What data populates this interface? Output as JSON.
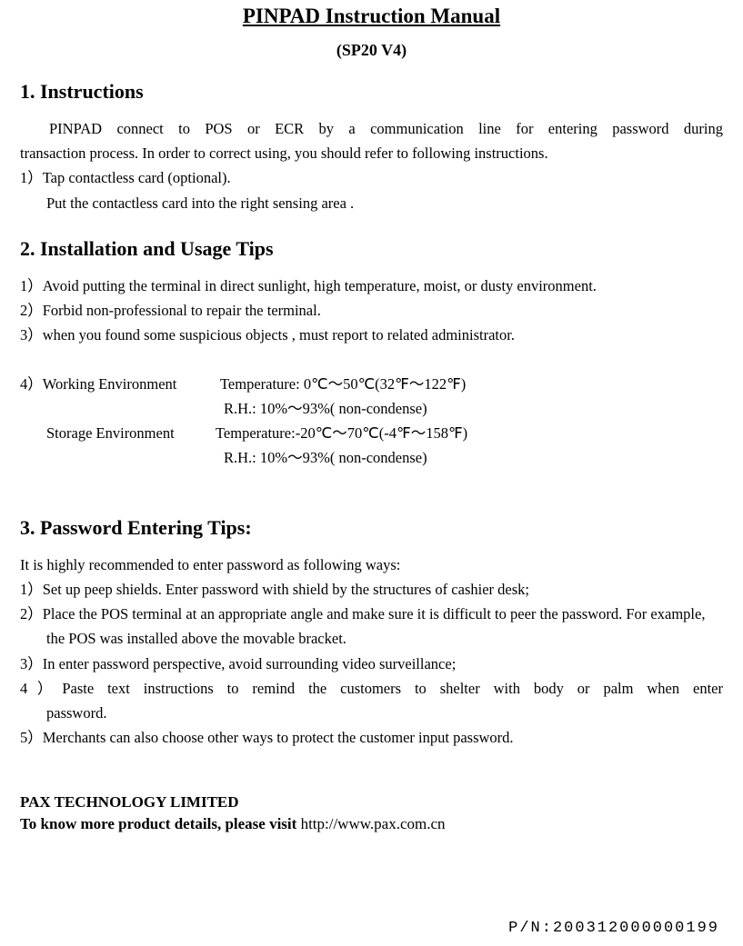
{
  "title": "PINPAD Instruction Manual",
  "subtitle": "(SP20 V4)",
  "section1": {
    "heading": "1. Instructions",
    "intro_line1": "PINPAD connect to POS or ECR by a communication line for entering password during",
    "intro_line2": "transaction process. In order to correct using, you should refer to following instructions.",
    "item1": "1）Tap contactless card (optional).",
    "item1_sub": "Put the contactless card into the right sensing area .",
    "intro_full": "PINPAD connect to POS or ECR by a communication line for entering password during transaction process. In order to correct using, you should refer to following instructions."
  },
  "section2": {
    "heading": "2. Installation and Usage Tips",
    "item1": "1）Avoid putting the terminal in direct sunlight, high temperature, moist, or dusty environment.",
    "item2": "2）Forbid non-professional to repair the terminal.",
    "item3": "3）when you found some suspicious objects , must report to related administrator.",
    "item4_label": "4）Working Environment",
    "item4_temp": "Temperature: 0℃～50℃(32℉～122℉)",
    "item4_rh": "R.H.: 10%～93%( non-condense)",
    "storage_label": "Storage Environment",
    "storage_temp": "Temperature:-20℃～70℃(-4℉～158℉)",
    "storage_rh": "R.H.: 10%～93%( non-condense)"
  },
  "section3": {
    "heading": "3. Password Entering Tips:",
    "intro": "It is highly recommended to enter password as following ways:",
    "item1": "1）Set up peep shields. Enter password with shield by the structures of cashier desk;",
    "item2": "2）Place the POS terminal at an appropriate angle and make sure it is difficult to peer the password. For example, the POS was installed above the movable bracket.",
    "item3": "3）In enter password perspective, avoid surrounding video surveillance;",
    "item4_line1": "4）Paste text instructions to remind the customers to shelter with body or palm when enter",
    "item4_line2": "password.",
    "item4_full": "4）Paste text instructions to remind the customers to shelter with body or palm when enter password.",
    "item5": "5）Merchants can also choose other ways to protect the customer input password."
  },
  "footer": {
    "company": "PAX TECHNOLOGY LIMITED",
    "link_prefix": "To know more product details, please visit ",
    "link_url": "http://www.pax.com.cn",
    "pn": "P/N:200312000000199"
  }
}
